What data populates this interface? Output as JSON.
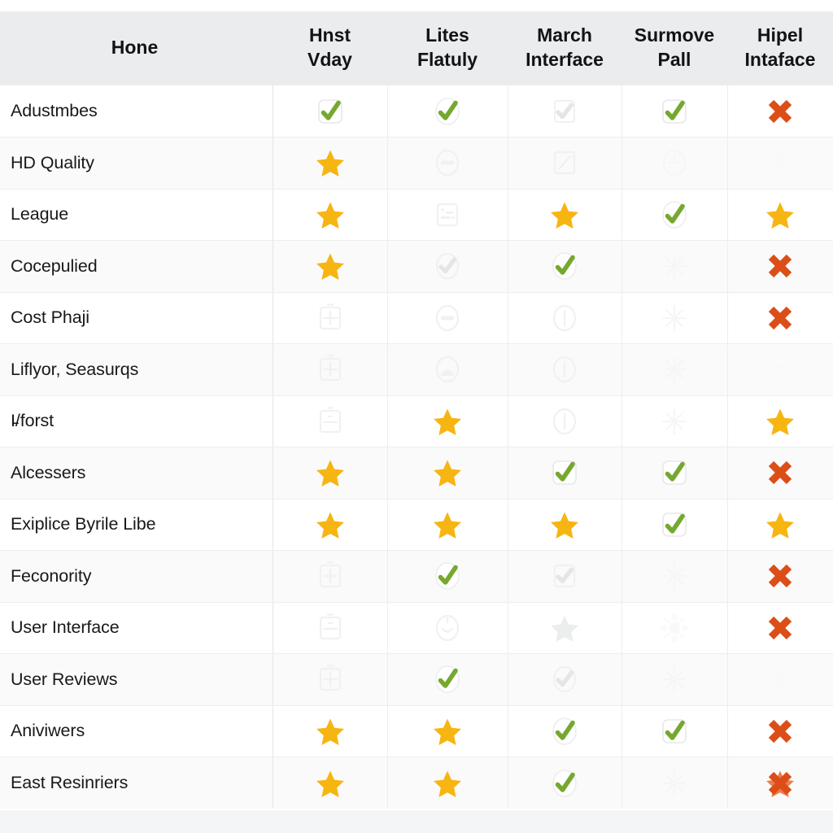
{
  "table": {
    "feature_column_header": "Hone",
    "columns": [
      {
        "line1": "Hnst",
        "line2": "Vday"
      },
      {
        "line1": "Lites",
        "line2": "Flatuly"
      },
      {
        "line1": "March",
        "line2": "Interface"
      },
      {
        "line1": "Surmove",
        "line2": "Pall"
      },
      {
        "line1": "Hipel",
        "line2": "Intaface"
      }
    ],
    "rows": [
      {
        "feature": "Adustmbes",
        "cells": [
          "check-box",
          "check-oval",
          "ghost-check-box",
          "check-box",
          "cross"
        ]
      },
      {
        "feature": "HD Quality",
        "cells": [
          "star",
          "ghost-minus-oval",
          "ghost-slash-box",
          "ghost-clock-oval",
          "ghost-burst"
        ]
      },
      {
        "feature": "League",
        "cells": [
          "star",
          "ghost-card-box",
          "star",
          "check-oval",
          "star"
        ]
      },
      {
        "feature": "Cocepulied",
        "cells": [
          "star",
          "ghost-check-oval",
          "check-oval",
          "ghost-spark",
          "cross"
        ]
      },
      {
        "feature": "Cost Phaji",
        "cells": [
          "ghost-plus-box",
          "ghost-minus-oval",
          "ghost-bar-oval",
          "ghost-spark",
          "cross"
        ]
      },
      {
        "feature": "Liflyor, Seasurqs",
        "cells": [
          "ghost-plus-box",
          "ghost-hill-oval",
          "ghost-bar-oval",
          "ghost-spark",
          "ghost-shield"
        ]
      },
      {
        "feature": "I̵/forst",
        "cells": [
          "ghost-minus-box",
          "star",
          "ghost-bar-oval",
          "ghost-spark",
          "star"
        ]
      },
      {
        "feature": "Alcessers",
        "cells": [
          "star",
          "star",
          "check-box",
          "check-box",
          "cross"
        ]
      },
      {
        "feature": "Exiplice Byrile Libe",
        "cells": [
          "star",
          "star",
          "star",
          "check-box",
          "star"
        ]
      },
      {
        "feature": "Feconority",
        "cells": [
          "ghost-plus-box",
          "check-oval",
          "ghost-check-box",
          "ghost-spark",
          "cross"
        ]
      },
      {
        "feature": "User Interface",
        "cells": [
          "ghost-minus-box",
          "ghost-smile-oval",
          "ghost-star",
          "ghost-burst",
          "cross"
        ]
      },
      {
        "feature": "User Reviews",
        "cells": [
          "ghost-plus-box",
          "check-oval",
          "ghost-check-oval",
          "ghost-spark",
          "ghost-burst"
        ]
      },
      {
        "feature": "Aniviwers",
        "cells": [
          "star",
          "star",
          "check-oval",
          "check-box",
          "cross"
        ]
      },
      {
        "feature": "East Resinriers",
        "cells": [
          "star",
          "star",
          "check-oval",
          "ghost-spark",
          "cross-star"
        ]
      }
    ]
  },
  "colors": {
    "check_green": "#76a830",
    "star_amber": "#f7b512",
    "cross_red": "#dc4e18",
    "header_bg": "#eaecee",
    "grid_line": "#eceded",
    "text": "#16181a",
    "row_alt": "#fafafa"
  },
  "icon_names": {
    "check-box": "check-icon",
    "check-oval": "check-icon",
    "star": "star-icon",
    "cross": "cross-icon",
    "cross-star": "cross-icon",
    "ghost-check-box": "placeholder-check-icon",
    "ghost-check-oval": "placeholder-check-icon",
    "ghost-star": "placeholder-star-icon",
    "ghost-plus-box": "placeholder-plus-icon",
    "ghost-minus-box": "placeholder-minus-icon",
    "ghost-minus-oval": "placeholder-minus-icon",
    "ghost-hill-oval": "placeholder-image-icon",
    "ghost-bar-oval": "placeholder-bar-icon",
    "ghost-clock-oval": "placeholder-clock-icon",
    "ghost-smile-oval": "placeholder-smiley-icon",
    "ghost-slash-box": "placeholder-slash-icon",
    "ghost-card-box": "placeholder-card-icon",
    "ghost-spark": "placeholder-sparkle-icon",
    "ghost-burst": "placeholder-burst-icon",
    "ghost-shield": "placeholder-shield-icon"
  }
}
